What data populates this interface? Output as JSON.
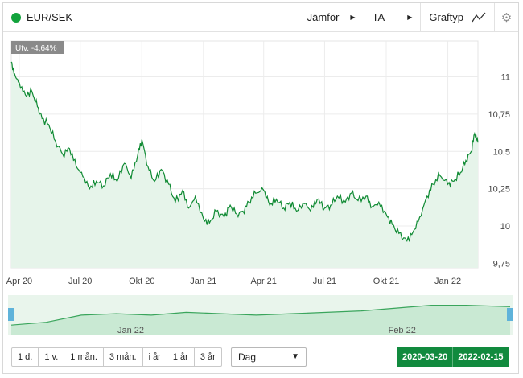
{
  "header": {
    "instrument": "EUR/SEK",
    "status_color": "#12a33c",
    "compare_label": "Jämför",
    "ta_label": "TA",
    "charttype_label": "Graftyp",
    "charttype_icon": "line-chart-icon",
    "settings_icon": "gear-icon"
  },
  "chart_data": {
    "type": "area",
    "change_badge": "Utv. -4,64%",
    "x_labels": [
      "Apr 20",
      "Jul 20",
      "Okt 20",
      "Jan 21",
      "Apr 21",
      "Jul 21",
      "Okt 21",
      "Jan 22"
    ],
    "y_labels": [
      "11",
      "10,75",
      "10,5",
      "10,25",
      "10",
      "9,75"
    ],
    "y_ticks": [
      11,
      10.75,
      10.5,
      10.25,
      10,
      9.75
    ],
    "ylim": [
      9.72,
      11.24
    ],
    "grid": true,
    "x_range": [
      "2020-03-20",
      "2022-02-15"
    ],
    "series": [
      {
        "points": [
          [
            "2020-03-20",
            11.1
          ],
          [
            "2020-03-25",
            11.02
          ],
          [
            "2020-04-01",
            10.96
          ],
          [
            "2020-04-10",
            10.88
          ],
          [
            "2020-04-20",
            10.9
          ],
          [
            "2020-04-28",
            10.8
          ],
          [
            "2020-05-05",
            10.72
          ],
          [
            "2020-05-15",
            10.68
          ],
          [
            "2020-05-25",
            10.57
          ],
          [
            "2020-06-05",
            10.48
          ],
          [
            "2020-06-15",
            10.52
          ],
          [
            "2020-06-25",
            10.4
          ],
          [
            "2020-07-05",
            10.33
          ],
          [
            "2020-07-15",
            10.25
          ],
          [
            "2020-07-25",
            10.3
          ],
          [
            "2020-08-05",
            10.27
          ],
          [
            "2020-08-15",
            10.35
          ],
          [
            "2020-08-25",
            10.3
          ],
          [
            "2020-09-05",
            10.42
          ],
          [
            "2020-09-15",
            10.32
          ],
          [
            "2020-09-25",
            10.48
          ],
          [
            "2020-10-01",
            10.58
          ],
          [
            "2020-10-10",
            10.4
          ],
          [
            "2020-10-20",
            10.3
          ],
          [
            "2020-10-30",
            10.38
          ],
          [
            "2020-11-10",
            10.28
          ],
          [
            "2020-11-20",
            10.16
          ],
          [
            "2020-12-01",
            10.24
          ],
          [
            "2020-12-10",
            10.12
          ],
          [
            "2020-12-20",
            10.2
          ],
          [
            "2021-01-01",
            10.05
          ],
          [
            "2021-01-10",
            10.02
          ],
          [
            "2021-01-20",
            10.1
          ],
          [
            "2021-02-01",
            10.06
          ],
          [
            "2021-02-10",
            10.14
          ],
          [
            "2021-02-20",
            10.08
          ],
          [
            "2021-03-01",
            10.1
          ],
          [
            "2021-03-10",
            10.16
          ],
          [
            "2021-03-20",
            10.22
          ],
          [
            "2021-04-01",
            10.24
          ],
          [
            "2021-04-10",
            10.14
          ],
          [
            "2021-04-20",
            10.18
          ],
          [
            "2021-05-01",
            10.12
          ],
          [
            "2021-05-10",
            10.16
          ],
          [
            "2021-05-20",
            10.1
          ],
          [
            "2021-06-01",
            10.15
          ],
          [
            "2021-06-10",
            10.1
          ],
          [
            "2021-06-20",
            10.18
          ],
          [
            "2021-07-01",
            10.12
          ],
          [
            "2021-07-10",
            10.14
          ],
          [
            "2021-07-20",
            10.2
          ],
          [
            "2021-08-01",
            10.16
          ],
          [
            "2021-08-10",
            10.22
          ],
          [
            "2021-08-20",
            10.17
          ],
          [
            "2021-09-01",
            10.2
          ],
          [
            "2021-09-10",
            10.13
          ],
          [
            "2021-09-20",
            10.16
          ],
          [
            "2021-10-01",
            10.08
          ],
          [
            "2021-10-10",
            10.01
          ],
          [
            "2021-10-20",
            9.95
          ],
          [
            "2021-11-01",
            9.9
          ],
          [
            "2021-11-10",
            9.96
          ],
          [
            "2021-11-20",
            10.06
          ],
          [
            "2021-12-01",
            10.2
          ],
          [
            "2021-12-10",
            10.28
          ],
          [
            "2021-12-20",
            10.34
          ],
          [
            "2022-01-01",
            10.28
          ],
          [
            "2022-01-10",
            10.3
          ],
          [
            "2022-01-20",
            10.36
          ],
          [
            "2022-01-28",
            10.44
          ],
          [
            "2022-02-05",
            10.5
          ],
          [
            "2022-02-10",
            10.62
          ],
          [
            "2022-02-15",
            10.56
          ]
        ]
      }
    ],
    "colors": {
      "line": "#0f8a33",
      "fill": "#e6f4ea",
      "grid": "#ececec"
    }
  },
  "navigator": {
    "labels": [
      "Jan 22",
      "Feb 22"
    ],
    "x_range": [
      "2021-12-20",
      "2022-02-15"
    ],
    "points": [
      [
        "2021-12-20",
        10.2
      ],
      [
        "2021-12-24",
        10.22
      ],
      [
        "2021-12-28",
        10.27
      ],
      [
        "2022-01-01",
        10.28
      ],
      [
        "2022-01-05",
        10.27
      ],
      [
        "2022-01-09",
        10.29
      ],
      [
        "2022-01-13",
        10.28
      ],
      [
        "2022-01-17",
        10.27
      ],
      [
        "2022-01-21",
        10.28
      ],
      [
        "2022-01-25",
        10.29
      ],
      [
        "2022-01-29",
        10.3
      ],
      [
        "2022-02-02",
        10.32
      ],
      [
        "2022-02-06",
        10.34
      ],
      [
        "2022-02-10",
        10.34
      ],
      [
        "2022-02-15",
        10.33
      ]
    ],
    "colors": {
      "line": "#3aa55c",
      "fill": "#c9e9d3",
      "handle": "#5fb3da"
    }
  },
  "controls": {
    "ranges": [
      "1 d.",
      "1 v.",
      "1 mån.",
      "3 mån.",
      "i år",
      "1 år",
      "3 år"
    ],
    "interval_selected": "Dag",
    "date_from": "2020-03-20",
    "date_to": "2022-02-15"
  }
}
